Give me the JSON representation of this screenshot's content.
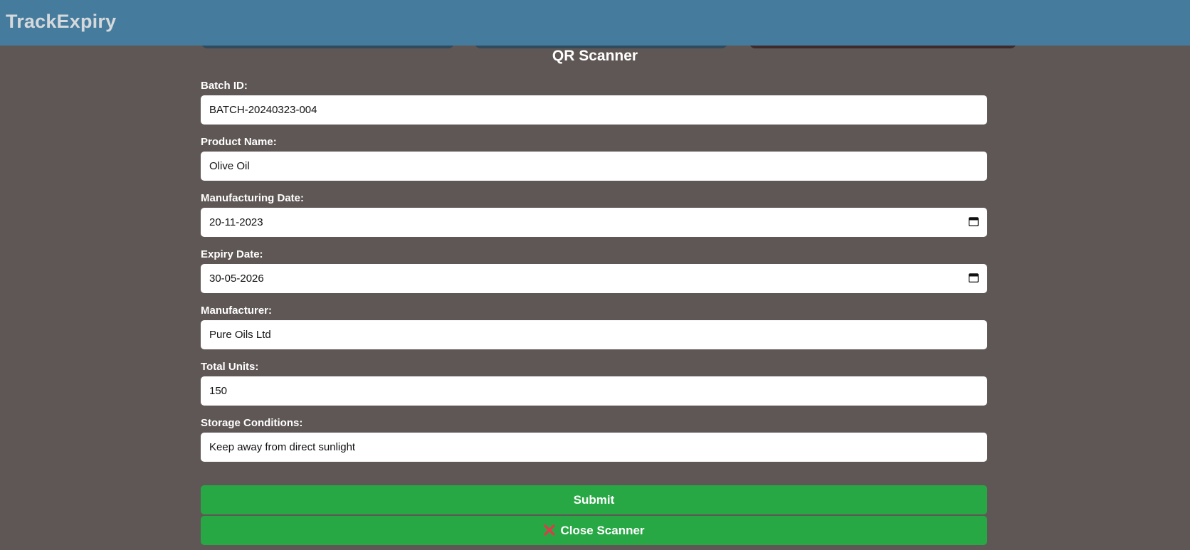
{
  "header": {
    "brand": "TrackExpiry",
    "color": "#457b9d"
  },
  "scanner": {
    "title": "QR Scanner"
  },
  "form": {
    "fields": [
      {
        "label": "Batch ID:",
        "value": "BATCH-20240323-004",
        "type": "text"
      },
      {
        "label": "Product Name:",
        "value": "Olive Oil",
        "type": "text"
      },
      {
        "label": "Manufacturing Date:",
        "value": "20-11-2023",
        "type": "date"
      },
      {
        "label": "Expiry Date:",
        "value": "30-05-2026",
        "type": "date"
      },
      {
        "label": "Manufacturer:",
        "value": "Pure Oils Ltd",
        "type": "text"
      },
      {
        "label": "Total Units:",
        "value": "150",
        "type": "text"
      },
      {
        "label": "Storage Conditions:",
        "value": "Keep away from direct sunlight",
        "type": "text"
      }
    ],
    "submit_label": "Submit",
    "close_label": "Close Scanner",
    "close_icon": "x-icon",
    "button_color": "#28a745",
    "close_icon_color": "#e0394a"
  },
  "background_color": "#5f5755"
}
